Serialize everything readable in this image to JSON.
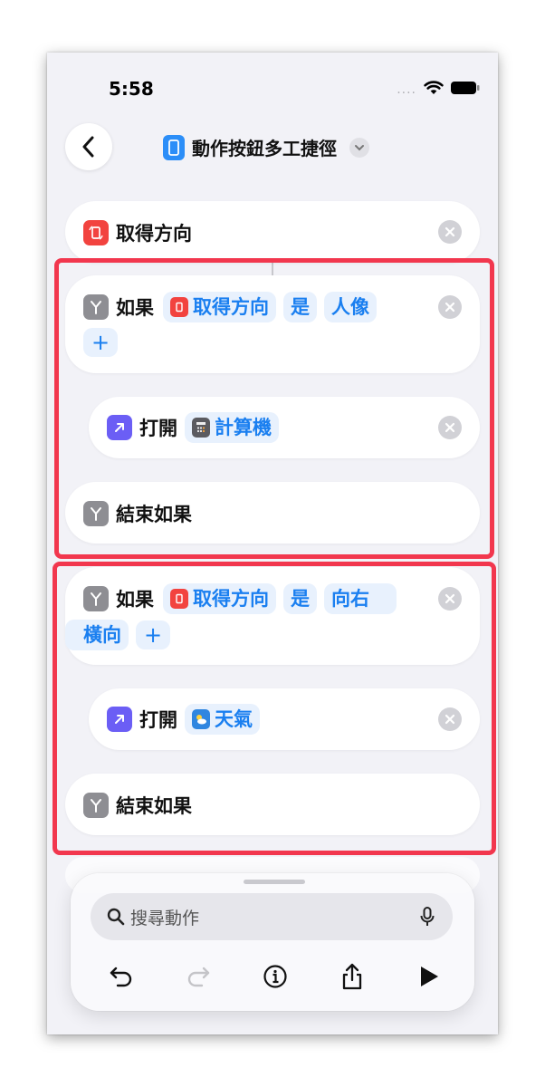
{
  "status": {
    "time": "5:58",
    "signal": "....",
    "wifi_icon": "wifi-icon",
    "battery_icon": "battery-icon"
  },
  "header": {
    "title": "動作按鈕多工捷徑",
    "back_icon": "chevron-left-icon",
    "app_icon": "phone-app-icon",
    "menu_icon": "chevron-down-icon"
  },
  "actions": {
    "get_orientation": {
      "label": "取得方向"
    },
    "if1": {
      "keyword": "如果",
      "var_label": "取得方向",
      "op": "是",
      "value": "人像",
      "add": "+"
    },
    "open1": {
      "verb": "打開",
      "app": "計算機"
    },
    "end1": {
      "label": "結束如果"
    },
    "if2": {
      "keyword": "如果",
      "var_label": "取得方向",
      "op": "是",
      "value_a": "向右",
      "value_b": "橫向",
      "add": "+"
    },
    "open2": {
      "verb": "打開",
      "app": "天氣"
    },
    "end2": {
      "label": "結束如果"
    }
  },
  "bottom": {
    "search_placeholder": "搜尋動作",
    "toolbar_icons": [
      "undo-icon",
      "redo-icon",
      "info-icon",
      "share-icon",
      "play-icon"
    ]
  },
  "colors": {
    "accent": "#1a7ff0",
    "highlight": "#f2374e",
    "orientation_icon": "#f2433f",
    "open_icon": "#6b5ef5",
    "if_icon": "#8e8e93"
  }
}
